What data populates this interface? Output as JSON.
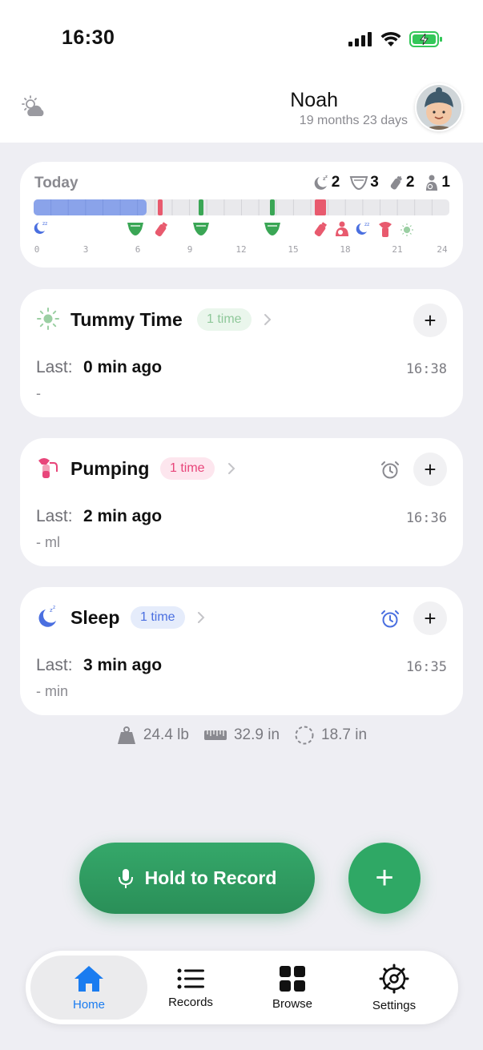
{
  "status_bar": {
    "time": "16:30"
  },
  "profile": {
    "name": "Noah",
    "age": "19 months 23 days"
  },
  "today": {
    "title": "Today",
    "counts": [
      {
        "icon": "sleep-moon-icon",
        "value": "2"
      },
      {
        "icon": "diaper-icon",
        "value": "3"
      },
      {
        "icon": "bottle-icon",
        "value": "2"
      },
      {
        "icon": "nursing-icon",
        "value": "1"
      }
    ],
    "axis_ticks": [
      "0",
      "3",
      "6",
      "9",
      "12",
      "15",
      "18",
      "21",
      "24"
    ]
  },
  "activities": [
    {
      "title": "Tummy Time",
      "count": "1 time",
      "last_label": "Last:",
      "last_value": "0 min  ago",
      "time": "16:38",
      "detail": "-"
    },
    {
      "title": "Pumping",
      "count": "1 time",
      "last_label": "Last:",
      "last_value": "2 min  ago",
      "time": "16:36",
      "detail": "- ml"
    },
    {
      "title": "Sleep",
      "count": "1 time",
      "last_label": "Last:",
      "last_value": "3 min  ago",
      "time": "16:35",
      "detail": "- min"
    }
  ],
  "measurements": {
    "weight": "24.4 lb",
    "height": "32.9 in",
    "head": "18.7 in"
  },
  "actions": {
    "record_label": "Hold to Record",
    "add_label": "+"
  },
  "tabs": [
    {
      "label": "Home",
      "icon": "house-icon"
    },
    {
      "label": "Records",
      "icon": "list-icon"
    },
    {
      "label": "Browse",
      "icon": "grid-icon"
    },
    {
      "label": "Settings",
      "icon": "gear-icon"
    }
  ],
  "colors": {
    "accent": "#1a7cf0",
    "green": "#2fa865",
    "pink": "#e8457a",
    "sleep_blue": "#8aa3ea"
  }
}
